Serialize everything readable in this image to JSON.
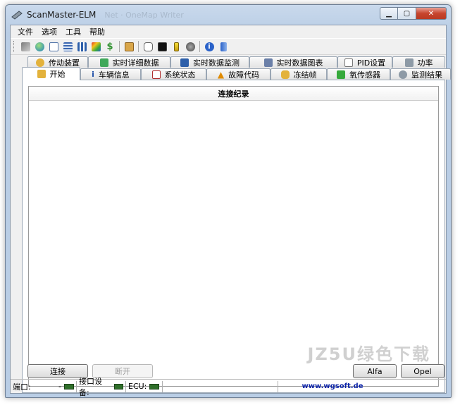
{
  "window": {
    "title": "ScanMaster-ELM",
    "ghost_title": "Net · OneMap Writer"
  },
  "menu": [
    "文件",
    "选项",
    "工具",
    "帮助"
  ],
  "toolbar_icons": [
    "connect-icon",
    "globe-icon",
    "document-icon",
    "table-icon",
    "chart-icon",
    "colorful-chart-icon",
    "money-icon",
    "clipboard-icon",
    "chat-icon",
    "terminal-icon",
    "battery-icon",
    "gauge-icon",
    "info-icon",
    "exit-icon"
  ],
  "tabs": {
    "row1": [
      "传动装置",
      "实时详细数据",
      "实时数据监测",
      "实时数据图表",
      "PID设置",
      "功率"
    ],
    "row2": [
      "开始",
      "车辆信息",
      "系统状态",
      "故障代码",
      "冻结帧",
      "氧传感器",
      "监测结果"
    ]
  },
  "log": {
    "header": "连接纪录"
  },
  "buttons": {
    "connect": "连接",
    "disconnect": "断开",
    "alfa": "Alfa",
    "opel": "Opel"
  },
  "status": {
    "port_label": "端口:",
    "port_value": "-",
    "interface_label": "接口设备:",
    "ecu_label": "ECU:",
    "url": "www.wgsoft.de"
  },
  "watermark": "JZ5U绿色下载",
  "colors": {
    "led": "#2f6f2a",
    "url": "#0b23a8",
    "close": "#c7452e"
  }
}
